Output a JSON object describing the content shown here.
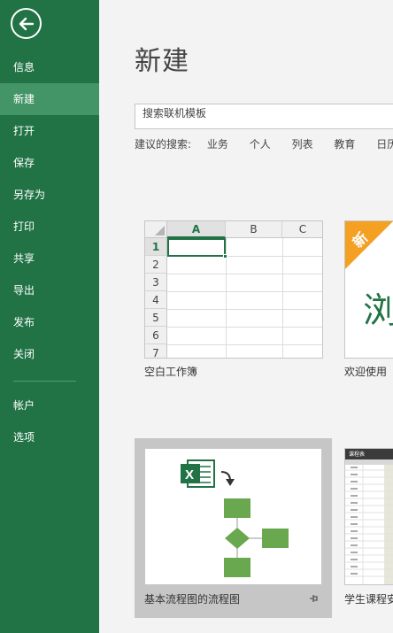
{
  "sidebar": {
    "back_icon": "back-arrow-icon",
    "items": [
      {
        "label": "信息",
        "active": false
      },
      {
        "label": "新建",
        "active": true
      },
      {
        "label": "打开",
        "active": false
      },
      {
        "label": "保存",
        "active": false
      },
      {
        "label": "另存为",
        "active": false
      },
      {
        "label": "打印",
        "active": false
      },
      {
        "label": "共享",
        "active": false
      },
      {
        "label": "导出",
        "active": false
      },
      {
        "label": "发布",
        "active": false
      },
      {
        "label": "关闭",
        "active": false
      }
    ],
    "bottom_items": [
      {
        "label": "帐户"
      },
      {
        "label": "选项"
      }
    ]
  },
  "main": {
    "title": "新建",
    "search": {
      "placeholder": "搜索联机模板"
    },
    "suggested": {
      "label": "建议的搜索:",
      "links": [
        "业务",
        "个人",
        "列表",
        "教育",
        "日历"
      ]
    },
    "templates": [
      {
        "label": "空白工作簿",
        "columns": [
          "A",
          "B",
          "C"
        ],
        "rows": [
          "1",
          "2",
          "3",
          "4",
          "5",
          "6",
          "7"
        ]
      },
      {
        "label": "欢迎使用",
        "badge": "新",
        "big_char": "浏"
      },
      {
        "label": "基本流程图的流程图",
        "pin_icon": "pin-icon"
      },
      {
        "label": "学生课程安",
        "sheet_title": "课程表"
      }
    ]
  },
  "colors": {
    "sidebar_bg": "#217346",
    "sidebar_active": "#439467",
    "accent_orange": "#f4a023",
    "flow_green": "#6aa84f"
  }
}
